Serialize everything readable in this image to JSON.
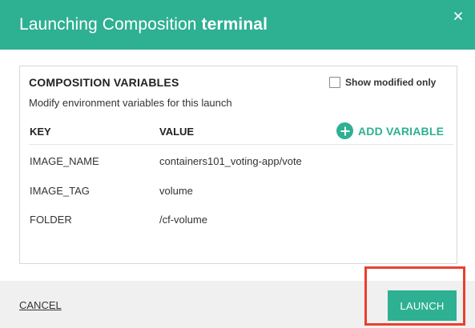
{
  "header": {
    "title_prefix": "Launching Composition",
    "composition_name": "terminal",
    "close_icon": "close-icon"
  },
  "panel": {
    "section_title": "COMPOSITION VARIABLES",
    "subtitle": "Modify environment variables for this launch",
    "show_modified": {
      "label": "Show modified only",
      "checked": false
    },
    "columns": {
      "key": "KEY",
      "value": "VALUE"
    },
    "add_variable": {
      "label": "ADD VARIABLE",
      "icon": "plus-circle-icon"
    },
    "rows": [
      {
        "key": "IMAGE_NAME",
        "value": "containers101_voting-app/vote"
      },
      {
        "key": "IMAGE_TAG",
        "value": "volume"
      },
      {
        "key": "FOLDER",
        "value": "/cf-volume"
      }
    ]
  },
  "footer": {
    "cancel_label": "CANCEL",
    "launch_label": "LAUNCH"
  },
  "colors": {
    "accent": "#2eb092",
    "highlight": "#e8402e",
    "footer_bg": "#f0f0f0"
  }
}
